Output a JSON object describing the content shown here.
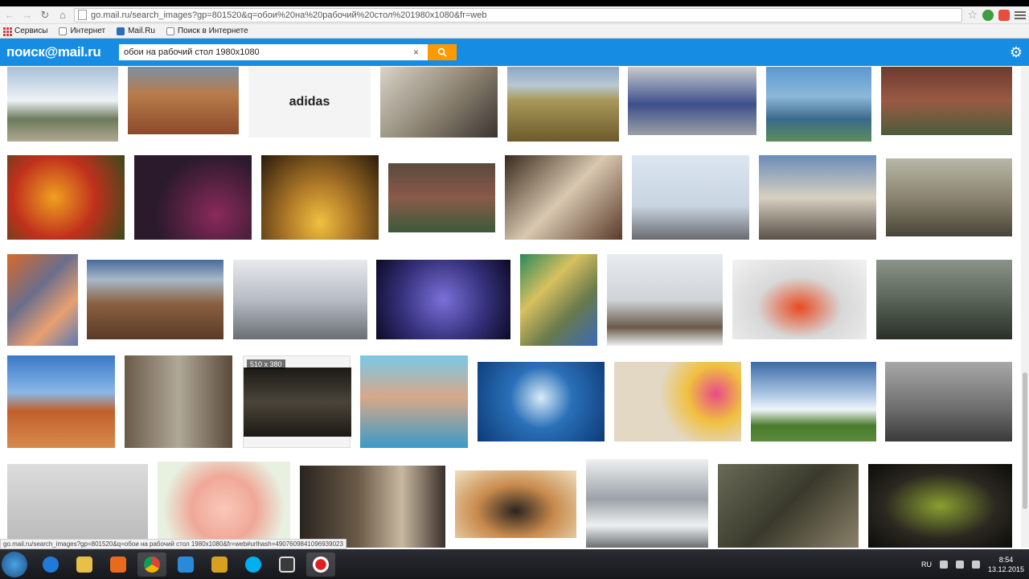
{
  "browser": {
    "url": "go.mail.ru/search_images?gp=801520&q=обои%20на%20рабочий%20стол%201980x1080&fr=web"
  },
  "bookmarks": [
    {
      "label": "Сервисы",
      "icon": "apps-grid-icon"
    },
    {
      "label": "Интернет",
      "icon": "page-icon"
    },
    {
      "label": "Mail.Ru",
      "icon": "mailru-icon"
    },
    {
      "label": "Поиск в Интернете",
      "icon": "page-icon"
    }
  ],
  "mailbar": {
    "logo": "поиск@mail.ru",
    "query": "обои на рабочий стол 1980x1080",
    "clear": "×",
    "search_icon": "search-icon",
    "settings_icon": "gear-icon"
  },
  "results": {
    "hover_badge": "510 x 380",
    "colors": {
      "mountains": "#8aa0b4",
      "canyon": "#a86a3c",
      "adidas": "#f4f4f4",
      "car_girl": "#9a8f78",
      "road": "#a99a58",
      "blue_car": "#3e4f8a",
      "city": "#4f7ea8",
      "rocks_red": "#8c4a3c",
      "cherries": "#c0301c",
      "bokeh": "#3a2a3c",
      "headphones": "#b07a28",
      "moss": "#7a5a4a",
      "anime": "#a0785a",
      "pebbles": "#c8d4e0",
      "supercars": "#a09080",
      "dino": "#8a8470",
      "collage": "#6a6e8c",
      "canyon2": "#8a6040",
      "viper": "#b8bcc4",
      "hex": "#35307a",
      "collage2": "#6a7a4a",
      "snow_cabin": "#d8dce0",
      "lambo": "#e84a20",
      "mech": "#5a6458",
      "monument": "#c0602c",
      "slot": "#8a8070",
      "limp": "#2c2a24",
      "beach": "#3a9ac8",
      "globe": "#2a70b8",
      "festivale": "#e2d8c4",
      "field": "#5a8ac0",
      "bw_player": "#8c8c8c",
      "plane_model": "#c8c8c8",
      "rose": "#f0b8a8",
      "bathroom": "#5a4a3c",
      "pilot": "#c88a4c",
      "village": "#9aa2a8",
      "fantasy": "#4a4a3c",
      "hotrod": "#2a2820"
    }
  },
  "status_url": "go.mail.ru/search_images?gp=801520&q=обои на рабочий стол 1980x1080&fr=web#urlhash=4907609841096939023",
  "taskbar": {
    "apps": [
      "ie-icon",
      "explorer-icon",
      "media-player-icon",
      "chrome-icon",
      "mail-agent-icon",
      "game-icon",
      "skype-icon",
      "video-editor-icon",
      "recorder-icon"
    ],
    "lang": "RU",
    "time": "8:54",
    "date": "13.12.2015"
  }
}
